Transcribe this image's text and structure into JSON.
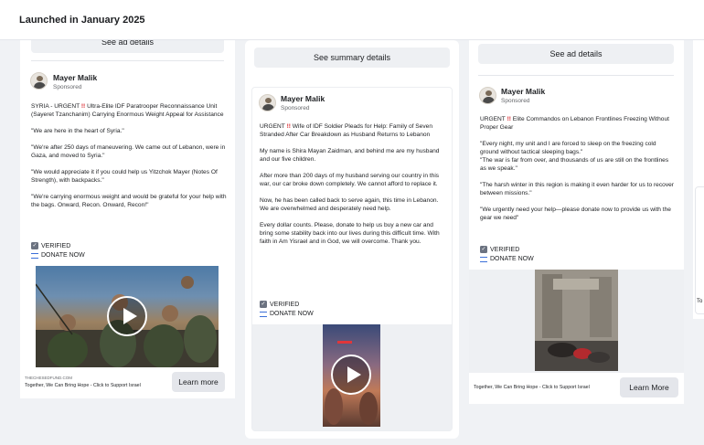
{
  "header": {
    "title": "Launched in January 2025"
  },
  "ads": [
    {
      "details_label": "See ad details",
      "advertiser": "Mayer Malik",
      "sponsored": "Sponsored",
      "headline_prefix": "SYRIA - URGENT ",
      "headline_mark": "!!",
      "headline_rest": " Ultra-Elite IDF Paratrooper Reconnaissance Unit (Sayeret Tzanchanim) Carrying Enormous Weight Appeal for Assistance",
      "paragraphs": [
        "\"We are here in the heart of Syria.\"",
        "\"We're after 250 days of maneuvering. We came out of Lebanon, were in Gaza, and moved to Syria.\"",
        "\"We would appreciate it if you could help us Yitzchok Mayer (Notes Of Strength), with backpacks.\"",
        "\"We're carrying enormous weight and would be grateful for your help with the bags. Onward, Recon. Onward, Recon!\""
      ],
      "verified": "VERIFIED",
      "donate": "DONATE NOW",
      "footer_url": "THECHESEDFUND.COM",
      "footer_caption": "Together, We Can Bring Hope - Click to Support Israel",
      "cta": "Learn more"
    },
    {
      "details_label": "See summary details",
      "advertiser": "Mayer Malik",
      "sponsored": "Sponsored",
      "headline_prefix": "URGENT ",
      "headline_mark": "!!",
      "headline_rest": " Wife of IDF Soldier Pleads for Help: Family of Seven Stranded After Car Breakdown as Husband Returns to Lebanon",
      "paragraphs": [
        "My name is Shira Mayan Zaidman, and behind me are my husband and our five children.",
        "After more than 200 days of my husband serving our country in this war, our car broke down completely. We cannot afford to replace it.",
        "Now, he has been called back to serve again, this time in Lebanon. We are overwhelmed and desperately need help.",
        "Every dollar counts. Please, donate to help us buy a new car and bring some stability back into our lives during this difficult time. With faith in Am Yisrael and in God, we will overcome. Thank you."
      ],
      "verified": "VERIFIED",
      "donate": "DONATE NOW"
    },
    {
      "details_label": "See ad details",
      "advertiser": "Mayer Malik",
      "sponsored": "Sponsored",
      "headline_prefix": "URGENT ",
      "headline_mark": "!!",
      "headline_rest": " Elite Commandos on Lebanon Frontlines Freezing Without Proper Gear",
      "paragraphs": [
        "\"Every night, my unit and I are forced to sleep on the freezing cold ground without tactical sleeping bags.\"\n\"The war is far from over, and thousands of us are still on the frontlines as we speak.\"",
        "\"The harsh winter in this region is making it even harder for us to recover between missions.\"",
        "\"We urgently need your help—please donate now to provide us with the gear we need\""
      ],
      "verified": "VERIFIED",
      "donate": "DONATE NOW",
      "footer_caption": "Together, We Can Bring Hope - Click to Support Israel",
      "cta": "Learn More"
    }
  ],
  "partial_right": {
    "text": "To"
  },
  "colors": {
    "accent_red": "#d9252b",
    "flag_blue": "#3b6fd8",
    "button_bg": "#e4e6eb"
  },
  "icons": [
    "play-icon",
    "verified-check-icon",
    "israel-flag-icon",
    "avatar-icon"
  ]
}
